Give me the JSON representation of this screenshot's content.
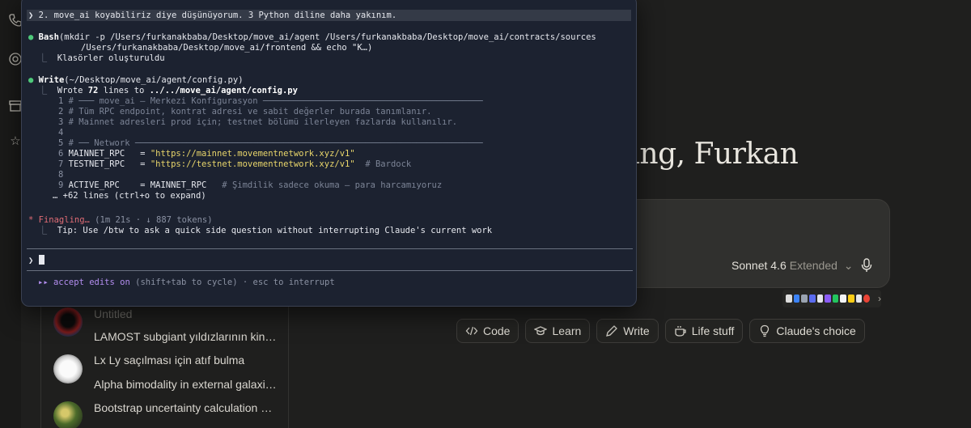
{
  "app": {
    "greeting": "rning, Furkan",
    "model_name": "Sonnet 4.6",
    "model_mode": "Extended",
    "chips": [
      {
        "label": "Code",
        "icon": "code-icon"
      },
      {
        "label": "Learn",
        "icon": "graduation-cap-icon"
      },
      {
        "label": "Write",
        "icon": "pen-icon"
      },
      {
        "label": "Life stuff",
        "icon": "coffee-icon"
      },
      {
        "label": "Claude's choice",
        "icon": "lightbulb-icon"
      }
    ],
    "recents": [
      "Untitled",
      "LAMOST subgiant yıldızlarının kin…",
      "Lx Ly saçılması için atıf bulma",
      "Alpha bimodality in external galaxi…",
      "Bootstrap uncertainty calculation …"
    ]
  },
  "terminal": {
    "user_prompt": "❯ 2. move_ai koyabiliriz diye düşünüyorum. 3 Python diline daha yakınım.",
    "bash_tool": "Bash",
    "bash_cmd_1": "(mkdir -p /Users/furkanakbaba/Desktop/move_ai/agent /Users/furkanakbaba/Desktop/move_ai/contracts/sources",
    "bash_cmd_2": "/Users/furkanakbaba/Desktop/move_ai/frontend && echo \"K…)",
    "bash_result": "Klasörler oluşturuldu",
    "write_tool": "Write",
    "write_path": "(~/Desktop/move_ai/agent/config.py)",
    "wrote_prefix": "Wrote ",
    "wrote_count": "72",
    "wrote_mid": " lines to ",
    "wrote_file": "../../move_ai/agent/config.py",
    "code_lines": [
      {
        "n": "1",
        "text": "# ─── move_ai — Merkezi Konfigurasyon ───────────────────────────────────────────"
      },
      {
        "n": "2",
        "text": "# Tüm RPC endpoint, kontrat adresi ve sabit değerler burada tanımlanır."
      },
      {
        "n": "3",
        "text": "# Mainnet adresleri prod için; testnet bölümü ilerleyen fazlarda kullanılır."
      },
      {
        "n": "4",
        "text": ""
      },
      {
        "n": "5",
        "text": "# ── Network ────────────────────────────────────────────────────────────────────"
      },
      {
        "n": "6",
        "code": "MAINNET_RPC   = ",
        "str": "\"https://mainnet.movementnetwork.xyz/v1\"",
        "cmt": ""
      },
      {
        "n": "7",
        "code": "TESTNET_RPC   = ",
        "str": "\"https://testnet.movementnetwork.xyz/v1\"",
        "cmt": "  # Bardock"
      },
      {
        "n": "8",
        "text": ""
      },
      {
        "n": "9",
        "code": "ACTIVE_RPC    = MAINNET_RPC",
        "str": "",
        "cmt": "   # Şimdilik sadece okuma — para harcamıyoruz"
      }
    ],
    "more_lines": "… +62 lines (ctrl+o to expand)",
    "status_label": "* Finagling…",
    "status_detail": " (1m 21s · ↓ 887 tokens)",
    "tip": "Tip: Use /btw to ask a quick side question without interrupting Claude's current work",
    "input_prompt": "❯",
    "footer_mode": "▸▸ accept edits on",
    "footer_hint": " (shift+tab to cycle) · esc to interrupt"
  }
}
